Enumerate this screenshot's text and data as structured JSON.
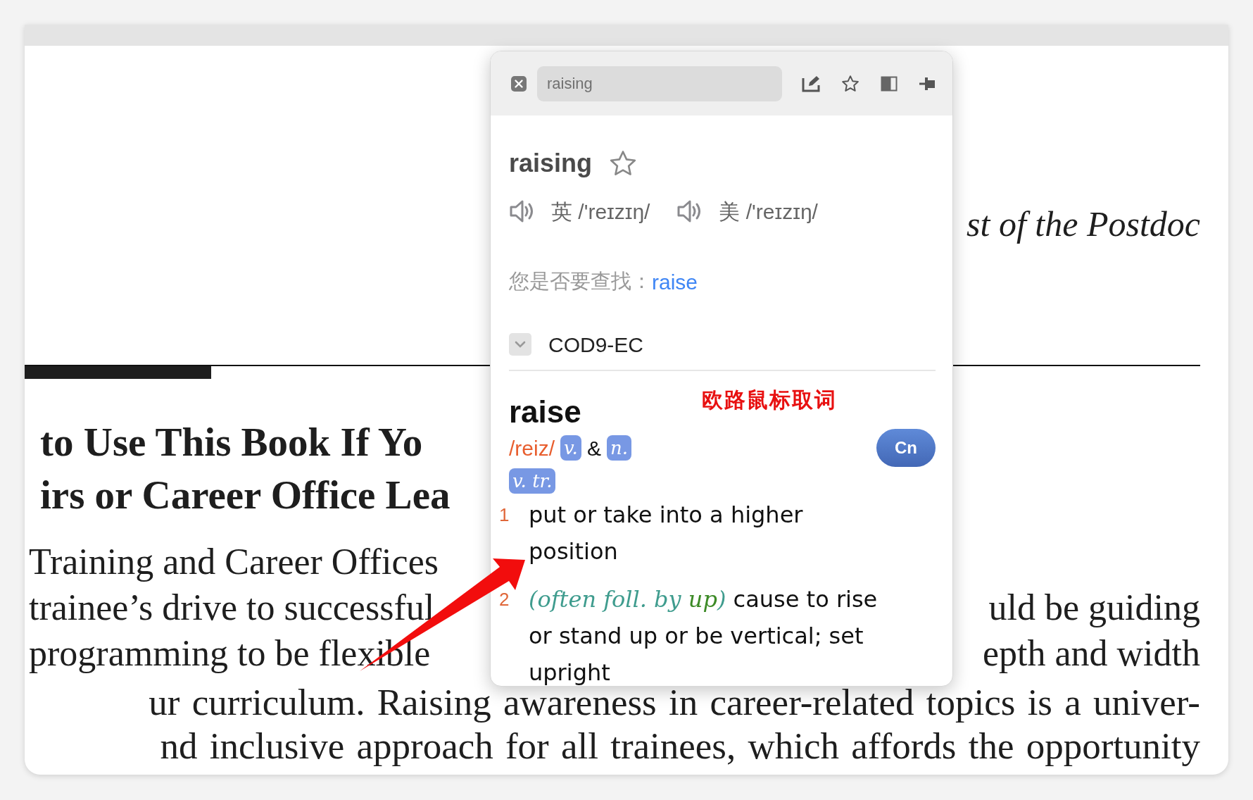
{
  "document": {
    "running_head": "st of the Postdoc",
    "heading_lines": [
      "to Use This Book If Yo",
      "irs or Career Office Lea"
    ],
    "body_lines": [
      {
        "left": "Training and Career Offices"
      },
      {
        "left": "trainee’s drive to successful",
        "right": "uld be guiding"
      },
      {
        "left": "programming to be flexible",
        "right": "epth and width"
      }
    ],
    "full_lines": [
      "ur curriculum. Raising awareness in career-related topics is a univer-",
      "nd inclusive approach for all trainees, which affords the opportunity"
    ]
  },
  "popup": {
    "search": {
      "value": "raising"
    },
    "word": "raising",
    "favorite": false,
    "pronunciations": [
      {
        "region": "英",
        "ipa": "/'reɪzɪŋ/"
      },
      {
        "region": "美",
        "ipa": "/'reɪzɪŋ/"
      }
    ],
    "suggestion": {
      "label": "您是否要查找：",
      "link": "raise"
    },
    "dictionary": {
      "name": "COD9-EC",
      "expanded": true
    },
    "entry": {
      "headword": "raise",
      "phonetic": "/reiz/",
      "pos": [
        "v.",
        "n."
      ],
      "joiner": "&",
      "language_button": "Cn",
      "sense_label": "v. tr.",
      "senses": [
        {
          "number": "1",
          "text": "put or take into a higher position"
        },
        {
          "number": "2",
          "label_parts": [
            {
              "text": "(often foll. by ",
              "color": "#3f9c8e"
            },
            {
              "text": "up",
              "color": "#3c8a26"
            },
            {
              "text": ")",
              "color": "#3f9c8e"
            }
          ],
          "text": "cause to rise or stand up or be vertical; set upright"
        }
      ]
    }
  },
  "annotation": {
    "text": "欧路鼠标取词"
  }
}
